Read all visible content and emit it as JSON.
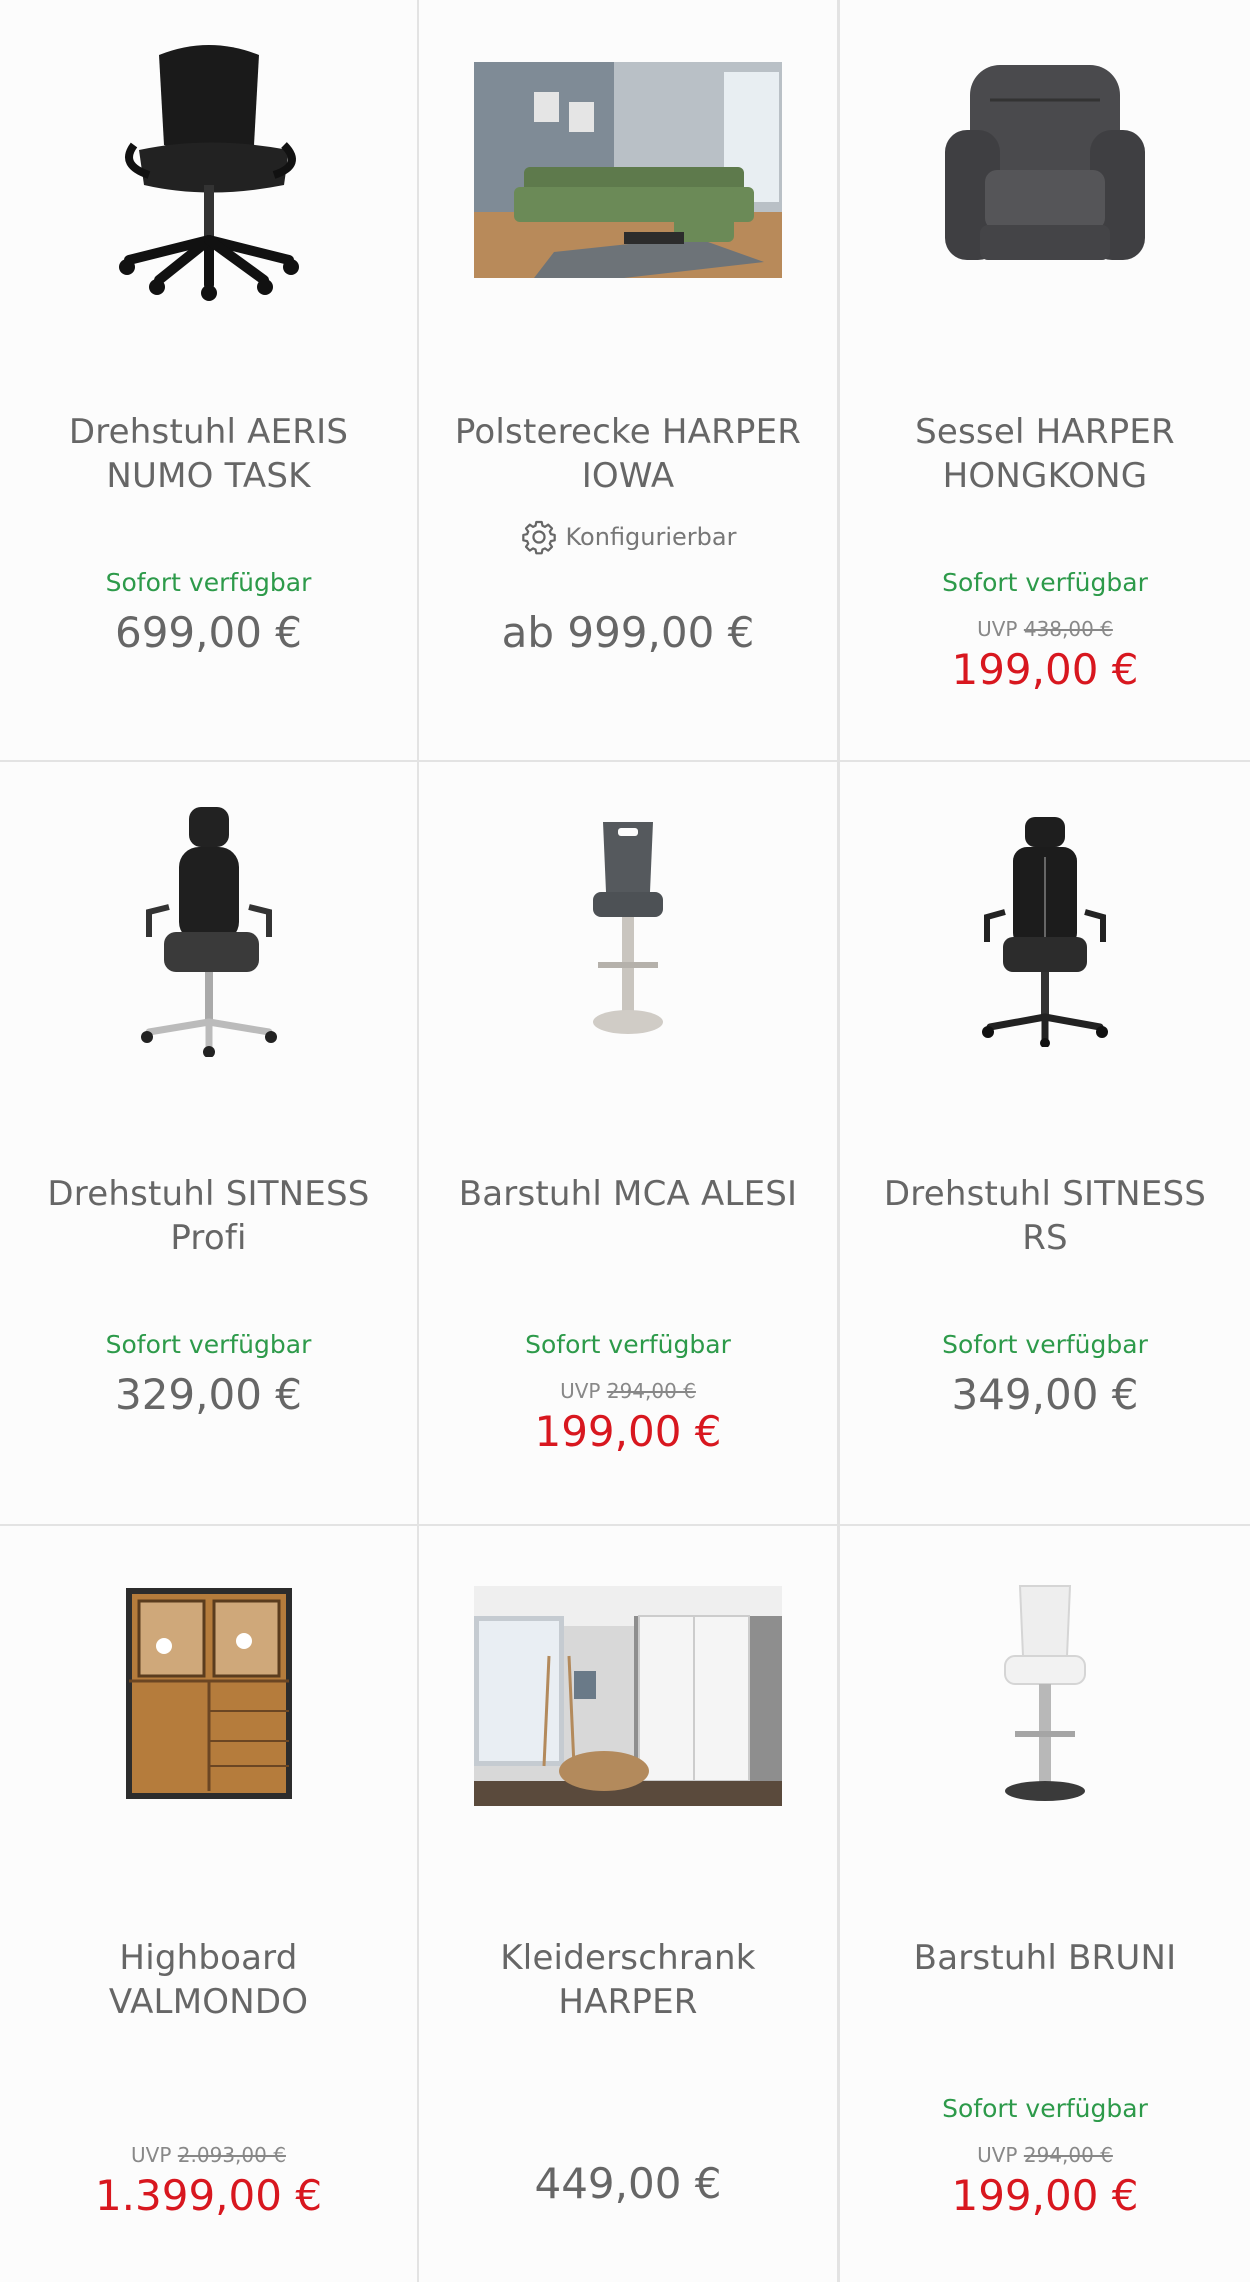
{
  "products": [
    {
      "name": "Drehstuhl AERIS NUMO TASK",
      "image_icon": "office-chair-black-icon",
      "availability": "Sofort verfügbar",
      "uvp_label": "",
      "uvp_price": "",
      "price": "699,00 €",
      "config_label": ""
    },
    {
      "name": "Polsterecke HARPER IOWA",
      "image_icon": "corner-sofa-green-photo",
      "availability": "",
      "uvp_label": "",
      "uvp_price": "",
      "price": "ab 999,00 €",
      "config_label": "Konfigurierbar"
    },
    {
      "name": "Sessel HARPER HONGKONG",
      "image_icon": "recliner-armchair-icon",
      "availability": "Sofort verfügbar",
      "uvp_label": "UVP",
      "uvp_price": "438,00 €",
      "price": "199,00 €",
      "config_label": ""
    },
    {
      "name": "Drehstuhl SITNESS Profi",
      "image_icon": "office-chair-headrest-icon",
      "availability": "Sofort verfügbar",
      "uvp_label": "",
      "uvp_price": "",
      "price": "329,00 €",
      "config_label": ""
    },
    {
      "name": "Barstuhl MCA ALESI",
      "image_icon": "bar-stool-grey-icon",
      "availability": "Sofort verfügbar",
      "uvp_label": "UVP",
      "uvp_price": "294,00 €",
      "price": "199,00 €",
      "config_label": ""
    },
    {
      "name": "Drehstuhl SITNESS RS",
      "image_icon": "gaming-chair-icon",
      "availability": "Sofort verfügbar",
      "uvp_label": "",
      "uvp_price": "",
      "price": "349,00 €",
      "config_label": ""
    },
    {
      "name": "Highboard VALMONDO",
      "image_icon": "wooden-highboard-icon",
      "availability": "",
      "uvp_label": "UVP",
      "uvp_price": "2.093,00 €",
      "price": "1.399,00 €",
      "config_label": ""
    },
    {
      "name": "Kleiderschrank HARPER",
      "image_icon": "wardrobe-room-photo",
      "availability": "",
      "uvp_label": "",
      "uvp_price": "",
      "price": "449,00 €",
      "config_label": ""
    },
    {
      "name": "Barstuhl BRUNI",
      "image_icon": "bar-stool-white-icon",
      "availability": "Sofort verfügbar",
      "uvp_label": "UVP",
      "uvp_price": "294,00 €",
      "price": "199,00 €",
      "config_label": ""
    }
  ],
  "colors": {
    "availability": "#2d9a4a",
    "sale_price": "#d8171f",
    "regular_price": "#666666",
    "divider": "#e3e3e3"
  }
}
